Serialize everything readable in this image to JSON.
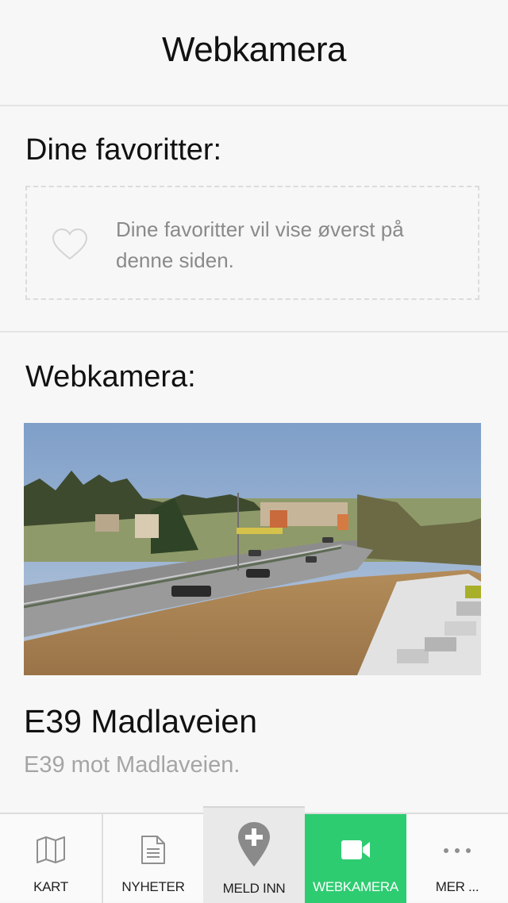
{
  "header": {
    "title": "Webkamera"
  },
  "favorites": {
    "title": "Dine favoritter:",
    "empty_text": "Dine favoritter vil vise øverst på denne siden."
  },
  "webcams": {
    "title": "Webkamera:",
    "items": [
      {
        "name": "E39 Madlaveien",
        "description": "E39 mot Madlaveien."
      }
    ]
  },
  "tabbar": {
    "active": "webkamera",
    "tabs": [
      {
        "id": "kart",
        "label": "KART",
        "icon": "map-icon"
      },
      {
        "id": "nyheter",
        "label": "NYHETER",
        "icon": "document-icon"
      },
      {
        "id": "meld-inn",
        "label": "MELD INN",
        "icon": "map-pin-plus-icon"
      },
      {
        "id": "webkamera",
        "label": "WEBKAMERA",
        "icon": "video-camera-icon"
      },
      {
        "id": "mer",
        "label": "MER ...",
        "icon": "more-dots-icon"
      }
    ]
  },
  "colors": {
    "accent": "#2ecc71",
    "background": "#f7f7f7"
  }
}
